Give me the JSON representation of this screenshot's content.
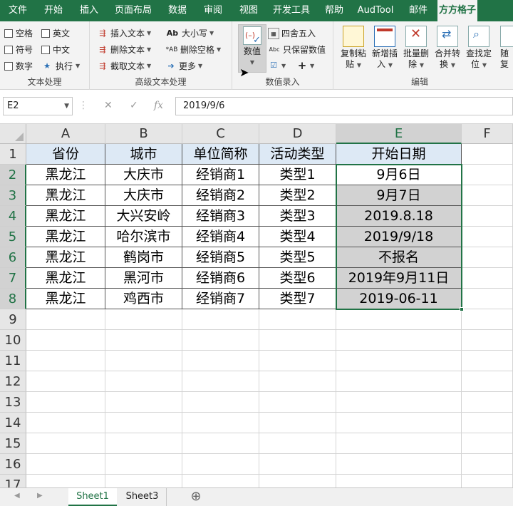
{
  "ribbon_tabs": [
    "文件",
    "开始",
    "插入",
    "页面布局",
    "数据",
    "审阅",
    "视图",
    "开发工具",
    "帮助",
    "AudTool",
    "邮件",
    "方方格子"
  ],
  "active_tab_index": 11,
  "groups": {
    "text": {
      "label": "文本处理",
      "checks": [
        "空格",
        "英文",
        "符号",
        "中文",
        "数字"
      ],
      "exec": "执行"
    },
    "adv_text": {
      "label": "高级文本处理",
      "insert": "插入文本",
      "delete": "删除文本",
      "cut": "截取文本",
      "case": "大小写",
      "delspace": "删除空格",
      "more": "更多"
    },
    "num_input": {
      "label": "数值录入",
      "value": "数值",
      "round": "四舍五入",
      "keep": "只保留数值"
    },
    "edit": {
      "label": "编辑",
      "buttons": [
        {
          "l1": "复制粘",
          "l2": "贴"
        },
        {
          "l1": "新增插",
          "l2": "入"
        },
        {
          "l1": "批量删",
          "l2": "除"
        },
        {
          "l1": "合并转",
          "l2": "换"
        },
        {
          "l1": "查找定",
          "l2": "位"
        },
        {
          "l1": "随",
          "l2": "复"
        }
      ]
    }
  },
  "formula_bar": {
    "name_box": "E2",
    "formula": "2019/9/6"
  },
  "columns": [
    "A",
    "B",
    "C",
    "D",
    "E",
    "F"
  ],
  "rows": [
    "1",
    "2",
    "3",
    "4",
    "5",
    "6",
    "7",
    "8",
    "9",
    "10",
    "11",
    "12",
    "13",
    "14",
    "15",
    "16",
    "17"
  ],
  "table": {
    "header": [
      "省份",
      "城市",
      "单位简称",
      "活动类型",
      "开始日期"
    ],
    "data": [
      [
        "黑龙江",
        "大庆市",
        "经销商1",
        "类型1",
        "9月6日"
      ],
      [
        "黑龙江",
        "大庆市",
        "经销商2",
        "类型2",
        "9月7日"
      ],
      [
        "黑龙江",
        "大兴安岭",
        "经销商3",
        "类型3",
        "2019.8.18"
      ],
      [
        "黑龙江",
        "哈尔滨市",
        "经销商4",
        "类型4",
        "2019/9/18"
      ],
      [
        "黑龙江",
        "鹤岗市",
        "经销商5",
        "类型5",
        "不报名"
      ],
      [
        "黑龙江",
        "黑河市",
        "经销商6",
        "类型6",
        "2019年9月11日"
      ],
      [
        "黑龙江",
        "鸡西市",
        "经销商7",
        "类型7",
        "2019-06-11"
      ]
    ]
  },
  "sheets": [
    "Sheet1",
    "Sheet3"
  ],
  "active_sheet": "Sheet1",
  "colors": {
    "accent": "#217346",
    "header_fill": "#dde9f5",
    "selected_fill": "#d2d2d2"
  }
}
